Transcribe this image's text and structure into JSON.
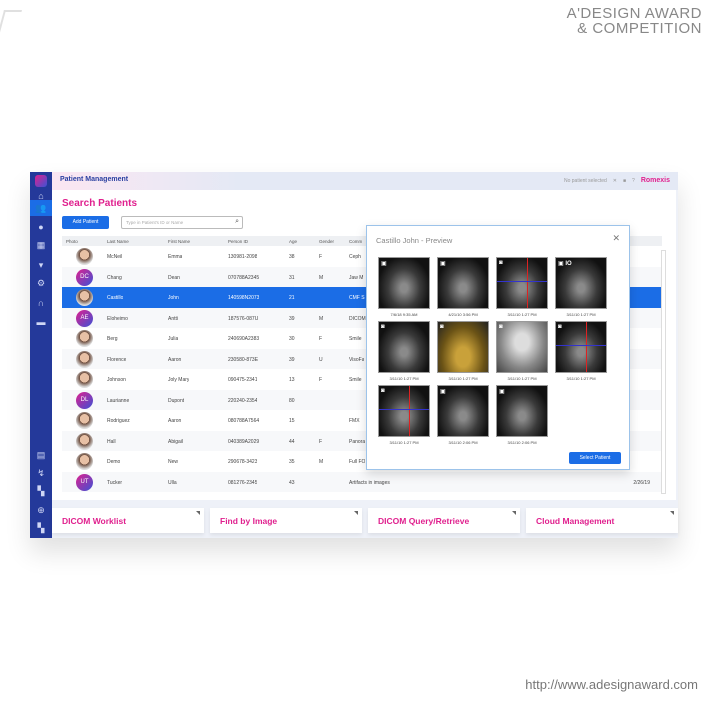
{
  "watermark": {
    "line1": "A'DESIGN AWARD",
    "line2": "& COMPETITION",
    "url": "http://www.adesignaward.com"
  },
  "header": {
    "title": "Patient Management",
    "status": "No patient selected",
    "brand": "Romexis"
  },
  "main": {
    "title": "Search Patients",
    "add_label": "Add Patient",
    "search_placeholder": "Type in Patient's ID or Name",
    "columns": [
      "Photo",
      "Last Name",
      "First Name",
      "Person ID",
      "Age",
      "Gender",
      "Comm"
    ],
    "rows": [
      {
        "initials": "",
        "last": "McNeil",
        "first": "Emma",
        "id": "130981-2098",
        "age": "38",
        "gender": "F",
        "comment": "Ceph",
        "date": ""
      },
      {
        "initials": "DC",
        "last": "Chang",
        "first": "Dean",
        "id": "070788A2345",
        "age": "31",
        "gender": "M",
        "comment": "Jaw M",
        "date": ""
      },
      {
        "initials": "",
        "last": "Castillo",
        "first": "John",
        "id": "140598N2073",
        "age": "21",
        "gender": "",
        "comment": "CMF S",
        "date": ""
      },
      {
        "initials": "AE",
        "last": "Eloheimo",
        "first": "Antti",
        "id": "187576-087U",
        "age": "39",
        "gender": "M",
        "comment": "DICOM",
        "date": ""
      },
      {
        "initials": "",
        "last": "Berg",
        "first": "Julia",
        "id": "240690A2383",
        "age": "30",
        "gender": "F",
        "comment": "Smile",
        "date": ""
      },
      {
        "initials": "",
        "last": "Florence",
        "first": "Aaron",
        "id": "230580-873E",
        "age": "39",
        "gender": "U",
        "comment": "VisoFa",
        "date": ""
      },
      {
        "initials": "",
        "last": "Johnson",
        "first": "Joly Mary",
        "id": "090475-2341",
        "age": "13",
        "gender": "F",
        "comment": "Smile",
        "date": ""
      },
      {
        "initials": "DL",
        "last": "Laurianne",
        "first": "Dupont",
        "id": "220240-2354",
        "age": "80",
        "gender": "",
        "comment": "",
        "date": ""
      },
      {
        "initials": "",
        "last": "Rodriguez",
        "first": "Aaron",
        "id": "080788A7564",
        "age": "15",
        "gender": "",
        "comment": "FMX",
        "date": ""
      },
      {
        "initials": "",
        "last": "Hall",
        "first": "Abigail",
        "id": "040389A2029",
        "age": "44",
        "gender": "F",
        "comment": "Panora",
        "date": ""
      },
      {
        "initials": "",
        "last": "Demo",
        "first": "New",
        "id": "290678-3423",
        "age": "35",
        "gender": "M",
        "comment": "Full FO",
        "date": ""
      },
      {
        "initials": "UT",
        "last": "Tucker",
        "first": "Ulla",
        "id": "081276-2345",
        "age": "43",
        "gender": "",
        "comment": "Artifacts in images",
        "date": "2/26/19"
      }
    ]
  },
  "preview": {
    "title": "Castillo John - Preview",
    "select_label": "Select Patient",
    "images": [
      {
        "icon": "3d",
        "date": "7/6/18 9:35 AM"
      },
      {
        "icon": "3d",
        "date": "4/21/10 3:56 PM"
      },
      {
        "icon": "camera",
        "date": "3/11/10 1:27 PM"
      },
      {
        "icon": "3d",
        "label": "IO",
        "date": "3/11/10 1:27 PM"
      },
      {
        "icon": "camera",
        "date": "3/11/10 1:27 PM"
      },
      {
        "icon": "camera",
        "date": "3/11/10 1:27 PM"
      },
      {
        "icon": "camera",
        "date": "3/11/10 1:27 PM"
      },
      {
        "icon": "camera",
        "date": "3/11/10 1:27 PM"
      },
      {
        "icon": "camera",
        "date": "3/11/10 1:27 PM"
      },
      {
        "icon": "3d",
        "date": "3/11/10 2:06 PM"
      },
      {
        "icon": "3d",
        "date": "3/11/10 2:06 PM"
      }
    ]
  },
  "tiles": [
    "DICOM Worklist",
    "Find by Image",
    "DICOM Query/Retrieve",
    "Cloud Management"
  ],
  "colors": {
    "accent": "#e0208e",
    "primary": "#1b6de6",
    "sidebar": "#24399a"
  }
}
